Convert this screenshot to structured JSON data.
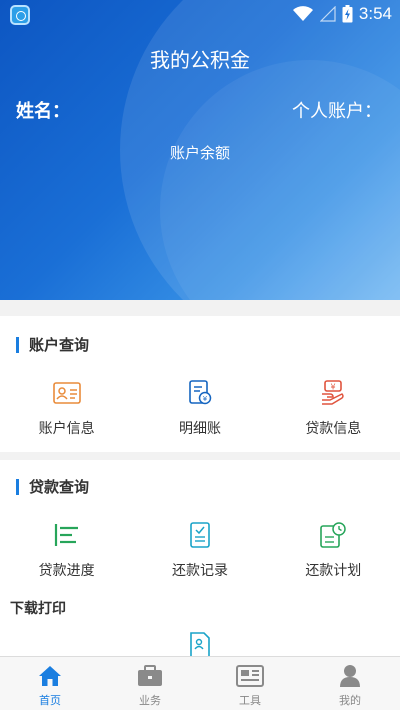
{
  "status_bar": {
    "time": "3:54"
  },
  "header": {
    "title": "我的公积金",
    "name_label": "姓名：",
    "account_label": "个人账户：",
    "balance_label": "账户余额"
  },
  "account_query": {
    "title": "账户查询",
    "items": [
      {
        "label": "账户信息",
        "icon": "id-card-icon"
      },
      {
        "label": "明细账",
        "icon": "ledger-icon"
      },
      {
        "label": "贷款信息",
        "icon": "loan-info-icon"
      }
    ]
  },
  "loan_query": {
    "title": "贷款查询",
    "items": [
      {
        "label": "贷款进度",
        "icon": "progress-icon"
      },
      {
        "label": "还款记录",
        "icon": "record-icon"
      },
      {
        "label": "还款计划",
        "icon": "plan-icon"
      }
    ]
  },
  "download_print": {
    "title": "下载打印"
  },
  "bottom_nav": {
    "items": [
      {
        "label": "首页",
        "active": true
      },
      {
        "label": "业务",
        "active": false
      },
      {
        "label": "工具",
        "active": false
      },
      {
        "label": "我的",
        "active": false
      }
    ]
  },
  "colors": {
    "accent": "#1a7ee0",
    "orange": "#e98b3a",
    "green": "#27a55a",
    "red": "#e0543e",
    "teal": "#1aa3c8"
  }
}
